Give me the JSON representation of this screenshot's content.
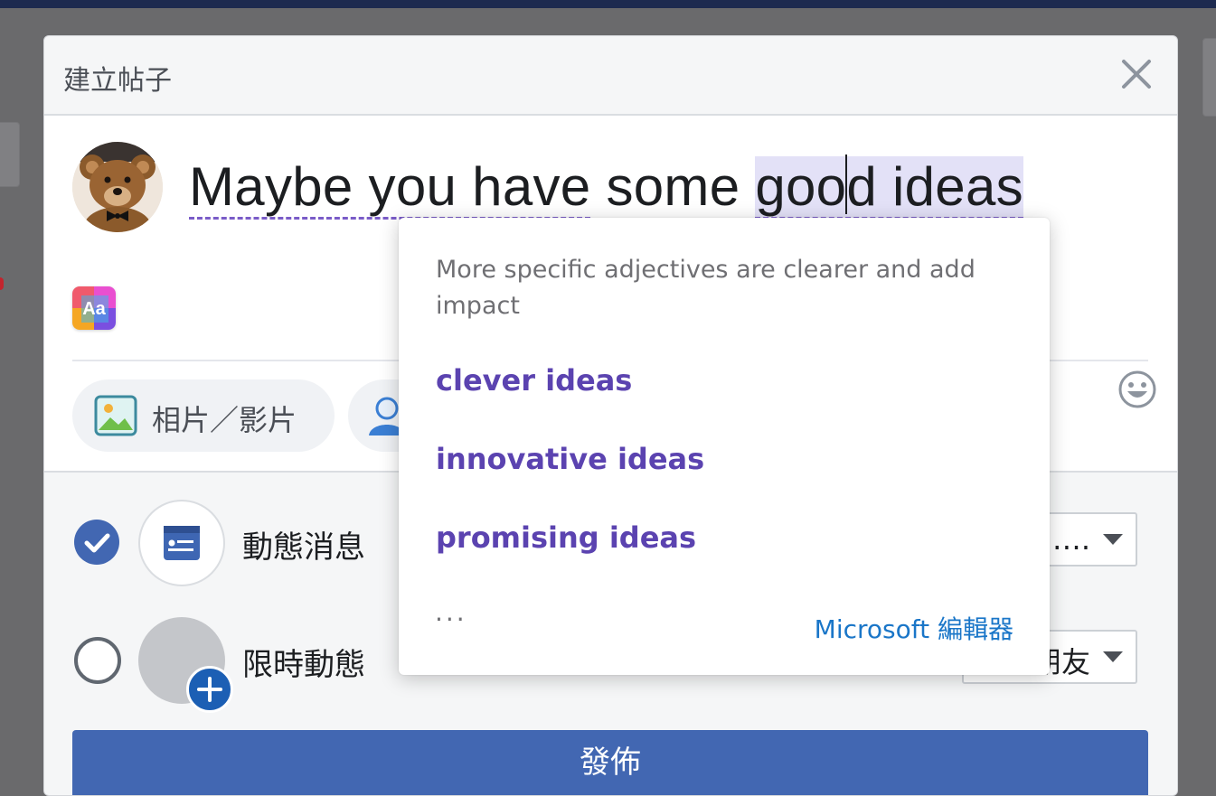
{
  "dialog": {
    "title": "建立帖子",
    "close_icon": "close-icon"
  },
  "composer": {
    "avatar": "teddy-bear-avatar",
    "text_before": "Maybe you have some ",
    "text_underlined_1": "Maybe you have",
    "highlight_pre_caret": "goo",
    "highlight_post_caret": "d ideas",
    "text_style_icon": "aa-icon",
    "emoji_icon": "smiley-icon"
  },
  "actions": {
    "photo_video_label": "相片／影片",
    "photo_icon": "photo-icon",
    "tag_icon": "person-icon"
  },
  "share": {
    "news_feed": {
      "label": "動態消息",
      "checked": true,
      "dropdown": "…."
    },
    "story": {
      "label": "限時動態",
      "checked": false,
      "dropdown": "朋友"
    }
  },
  "publish_label": "發佈",
  "editor_popup": {
    "description": "More specific adjectives are clearer and add impact",
    "suggestions": [
      "clever ideas",
      "innovative ideas",
      "promising ideas"
    ],
    "more_label": "···",
    "brand_label": "Microsoft 編輯器"
  },
  "colors": {
    "accent": "#4267b2",
    "suggestion": "#5b43b0",
    "brand": "#1a76c8"
  }
}
